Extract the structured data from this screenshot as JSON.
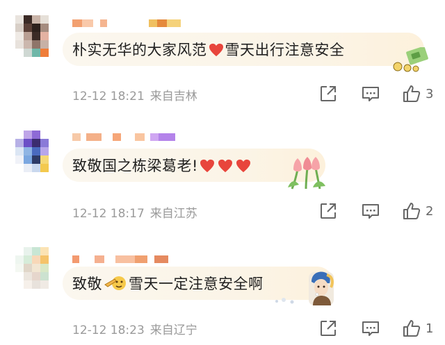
{
  "comments": [
    {
      "text_parts": [
        "朴实无华的大家风范",
        "雪天出行注意安全"
      ],
      "time": "12-12 18:21",
      "location": "来自吉林",
      "likes": "3",
      "sticker": "money-sticker-icon",
      "colors": {
        "heart": "#e8453c"
      }
    },
    {
      "text_parts": [
        "致敬国之栋梁葛老!"
      ],
      "time": "12-12 18:17",
      "location": "来自江苏",
      "likes": "2",
      "sticker": "tulip-sticker-icon",
      "colors": {
        "heart": "#e8453c"
      }
    },
    {
      "text_parts": [
        "致敬",
        "雪天一定注意安全啊"
      ],
      "time": "12-12 18:23",
      "location": "来自辽宁",
      "likes": "1",
      "sticker": "pearl-earring-girl-sticker-icon",
      "colors": {
        "heart": "#e8453c"
      }
    }
  ],
  "icons": {
    "share": "share-icon",
    "comment": "comment-icon",
    "like": "thumbs-up-icon"
  }
}
